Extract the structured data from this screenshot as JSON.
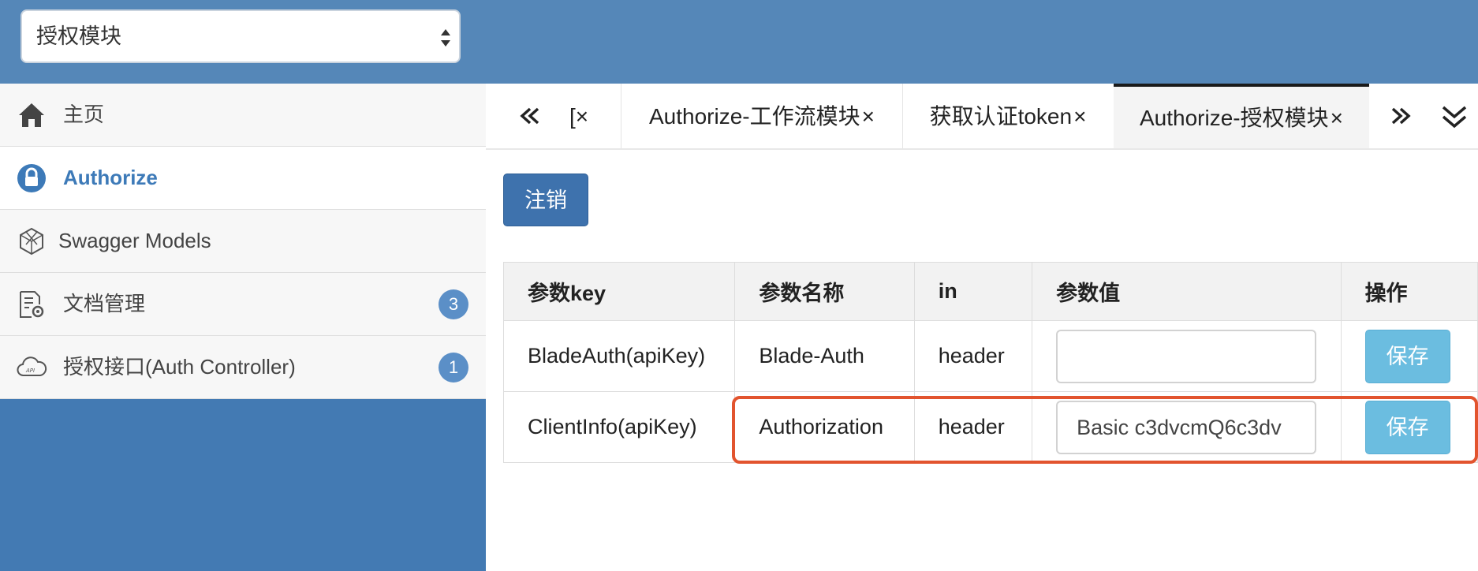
{
  "module_select": {
    "value": "授权模块"
  },
  "sidebar": {
    "items": [
      {
        "label": "主页",
        "icon": "home-icon"
      },
      {
        "label": "Authorize",
        "icon": "lock-icon",
        "active": true
      },
      {
        "label": "Swagger Models",
        "icon": "cube-icon"
      },
      {
        "label": "文档管理",
        "icon": "doc-settings-icon",
        "badge": "3"
      },
      {
        "label": "授权接口(Auth Controller)",
        "icon": "cloud-api-icon",
        "badge": "1"
      }
    ]
  },
  "tabs": {
    "partial_label": "[×",
    "items": [
      {
        "label": "Authorize-工作流模块",
        "close": "×"
      },
      {
        "label": "获取认证token",
        "close": "×"
      },
      {
        "label": "Authorize-授权模块",
        "close": "×",
        "active": true
      }
    ]
  },
  "logout_label": "注销",
  "table": {
    "headers": [
      "参数key",
      "参数名称",
      "in",
      "参数值",
      "操作"
    ],
    "rows": [
      {
        "key": "BladeAuth(apiKey)",
        "name": "Blade-Auth",
        "in": "header",
        "value": "",
        "action": "保存"
      },
      {
        "key": "ClientInfo(apiKey)",
        "name": "Authorization",
        "in": "header",
        "value": "Basic c3dvcmQ6c3dv",
        "action": "保存"
      }
    ]
  },
  "colors": {
    "header_bg": "#5587b8",
    "sidebar_bg": "#437ab3",
    "accent": "#3d7ab8",
    "save_button": "#6bbde0",
    "highlight_border": "#e2542e"
  }
}
